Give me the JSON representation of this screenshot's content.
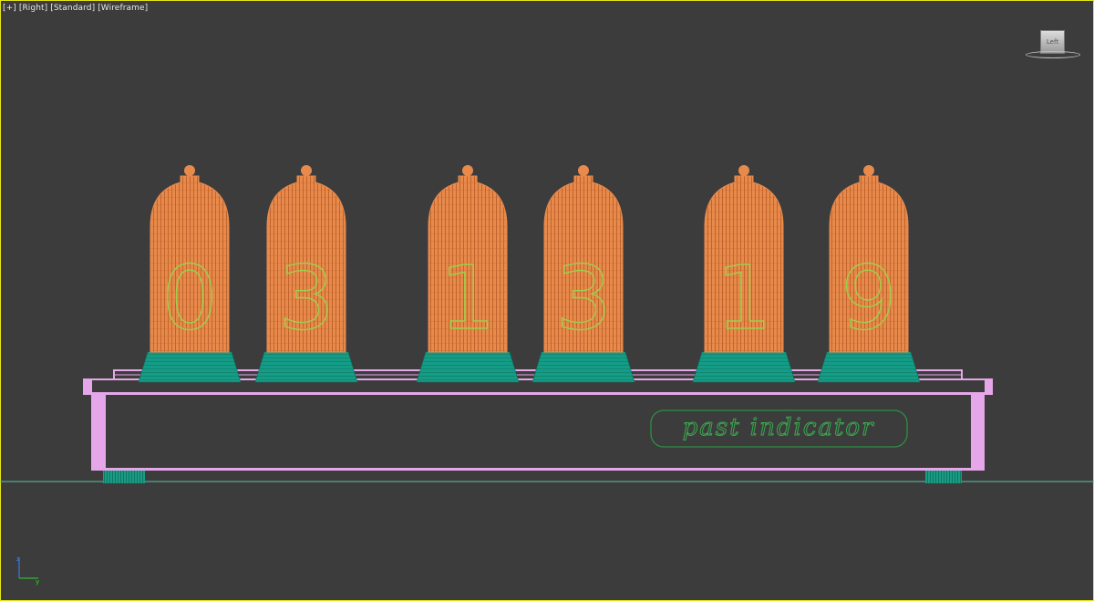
{
  "viewport": {
    "label_plus": "[+]",
    "label_view": "[Right]",
    "label_shading": "[Standard]",
    "label_mode": "[Wireframe]"
  },
  "viewcube": {
    "face_label": "Left"
  },
  "model": {
    "nameplate_text": "past indicator",
    "tube_digits": [
      "0",
      "3",
      "1",
      "3",
      "1",
      "9"
    ]
  },
  "colors": {
    "background": "#3c3c3c",
    "tube_glass": "#e88a4c",
    "tube_base": "#159c86",
    "case": "#e6a7ea",
    "nameplate": "#2e8f44",
    "digit": "#9dd04a",
    "grid_line": "#59c4a5"
  }
}
